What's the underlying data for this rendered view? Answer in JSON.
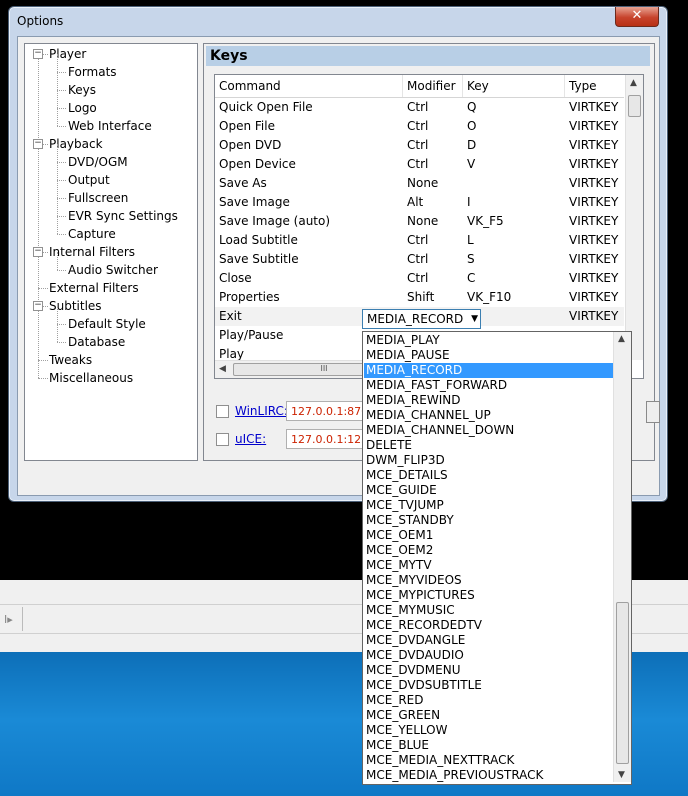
{
  "window": {
    "title": "Options",
    "close_glyph": "✕"
  },
  "tree": {
    "items": [
      {
        "label": "Player",
        "level": 0,
        "expander": "−"
      },
      {
        "label": "Formats",
        "level": 1
      },
      {
        "label": "Keys",
        "level": 1
      },
      {
        "label": "Logo",
        "level": 1
      },
      {
        "label": "Web Interface",
        "level": 1
      },
      {
        "label": "Playback",
        "level": 0,
        "expander": "−"
      },
      {
        "label": "DVD/OGM",
        "level": 1
      },
      {
        "label": "Output",
        "level": 1
      },
      {
        "label": "Fullscreen",
        "level": 1
      },
      {
        "label": "EVR Sync Settings",
        "level": 1
      },
      {
        "label": "Capture",
        "level": 1
      },
      {
        "label": "Internal Filters",
        "level": 0,
        "expander": "−"
      },
      {
        "label": "Audio Switcher",
        "level": 1
      },
      {
        "label": "External Filters",
        "level": 0
      },
      {
        "label": "Subtitles",
        "level": 0,
        "expander": "−"
      },
      {
        "label": "Default Style",
        "level": 1
      },
      {
        "label": "Database",
        "level": 1
      },
      {
        "label": "Tweaks",
        "level": 0
      },
      {
        "label": "Miscellaneous",
        "level": 0
      }
    ]
  },
  "keys": {
    "title": "Keys",
    "columns": [
      "Command",
      "Modifier",
      "Key",
      "Type"
    ],
    "rows": [
      [
        "Quick Open File",
        "Ctrl",
        "Q",
        "VIRTKEY"
      ],
      [
        "Open File",
        "Ctrl",
        "O",
        "VIRTKEY"
      ],
      [
        "Open DVD",
        "Ctrl",
        "D",
        "VIRTKEY"
      ],
      [
        "Open Device",
        "Ctrl",
        "V",
        "VIRTKEY"
      ],
      [
        "Save As",
        "None",
        "",
        "VIRTKEY"
      ],
      [
        "Save Image",
        "Alt",
        "I",
        "VIRTKEY"
      ],
      [
        "Save Image (auto)",
        "None",
        "VK_F5",
        "VIRTKEY"
      ],
      [
        "Load Subtitle",
        "Ctrl",
        "L",
        "VIRTKEY"
      ],
      [
        "Save Subtitle",
        "Ctrl",
        "S",
        "VIRTKEY"
      ],
      [
        "Close",
        "Ctrl",
        "C",
        "VIRTKEY"
      ],
      [
        "Properties",
        "Shift",
        "VK_F10",
        "VIRTKEY"
      ],
      [
        "Exit",
        "",
        "",
        "VIRTKEY"
      ],
      [
        "Play/Pause",
        "",
        "",
        ""
      ],
      [
        "Play",
        "",
        "",
        ""
      ]
    ],
    "selected_row": 11,
    "hscroll_grip": "III"
  },
  "combo": {
    "value": "MEDIA_RECORD",
    "arrow": "▼"
  },
  "dropdown": {
    "highlighted": "MEDIA_RECORD",
    "options": [
      "MEDIA_PLAY",
      "MEDIA_PAUSE",
      "MEDIA_RECORD",
      "MEDIA_FAST_FORWARD",
      "MEDIA_REWIND",
      "MEDIA_CHANNEL_UP",
      "MEDIA_CHANNEL_DOWN",
      "DELETE",
      "DWM_FLIP3D",
      "MCE_DETAILS",
      "MCE_GUIDE",
      "MCE_TVJUMP",
      "MCE_STANDBY",
      "MCE_OEM1",
      "MCE_OEM2",
      "MCE_MYTV",
      "MCE_MYVIDEOS",
      "MCE_MYPICTURES",
      "MCE_MYMUSIC",
      "MCE_RECORDEDTV",
      "MCE_DVDANGLE",
      "MCE_DVDAUDIO",
      "MCE_DVDMENU",
      "MCE_DVDSUBTITLE",
      "MCE_RED",
      "MCE_GREEN",
      "MCE_YELLOW",
      "MCE_BLUE",
      "MCE_MEDIA_NEXTTRACK",
      "MCE_MEDIA_PREVIOUSTRACK"
    ]
  },
  "remote": {
    "winlirc": {
      "label": "WinLIRC:",
      "address": "127.0.0.1:876"
    },
    "uice": {
      "label": "uICE:",
      "address": "127.0.0.1:123"
    }
  },
  "taskbar": {
    "arrow_glyph": "I▸"
  },
  "colors": {
    "highlight": "#3399ff",
    "panel_title": "#b8cfe6",
    "close": "#c7432c"
  }
}
